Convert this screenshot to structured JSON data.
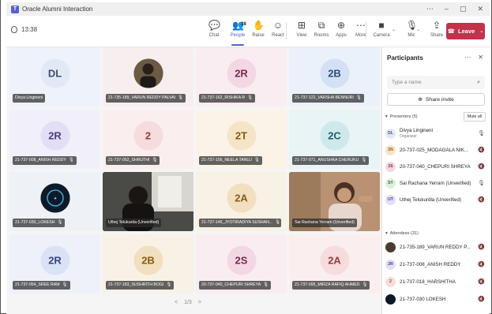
{
  "window": {
    "title": "Oracle Alumni Interaction",
    "app_icon": "teams-icon"
  },
  "toolbar": {
    "timer": "13:38",
    "buttons": [
      {
        "id": "chat",
        "label": "Chat",
        "icon": "chat-icon",
        "glyph": "💬"
      },
      {
        "id": "people",
        "label": "People",
        "icon": "people-icon",
        "glyph": "👥",
        "badge": "38"
      },
      {
        "id": "raise",
        "label": "Raise",
        "icon": "hand-icon",
        "glyph": "✋"
      },
      {
        "id": "react",
        "label": "React",
        "icon": "smiley-icon",
        "glyph": "☺"
      },
      {
        "id": "view",
        "label": "View",
        "icon": "grid-icon",
        "glyph": "⊞"
      },
      {
        "id": "rooms",
        "label": "Rooms",
        "icon": "rooms-icon",
        "glyph": "⧉"
      },
      {
        "id": "apps",
        "label": "Apps",
        "icon": "apps-icon",
        "glyph": "⊕"
      },
      {
        "id": "more",
        "label": "More",
        "icon": "ellipsis-icon",
        "glyph": "⋯"
      },
      {
        "id": "camera",
        "label": "Camera",
        "icon": "camera-off-icon",
        "glyph": "■"
      },
      {
        "id": "mic",
        "label": "Mic",
        "icon": "mic-icon",
        "glyph": "🎙"
      },
      {
        "id": "share",
        "label": "Share",
        "icon": "share-icon",
        "glyph": "⇪"
      }
    ],
    "leave_label": "Leave",
    "leave_color": "#c4314b"
  },
  "tiles": [
    {
      "name": "Divya Lingineni",
      "initials": "DL",
      "bg": "#eef3fb",
      "fg": "#3d4f73",
      "av": "#e2e9f6",
      "type": "avatar",
      "muted": false
    },
    {
      "name": "21-735-189_VARUN REDDY PALVAI",
      "initials": "",
      "bg": "#f7eeef",
      "fg": "#333",
      "av": "#4a3a30",
      "type": "photo",
      "muted": true
    },
    {
      "name": "21-737-162_RISHIKA R",
      "initials": "2R",
      "bg": "#f9edf2",
      "fg": "#7a2a4e",
      "av": "#f3d7e4",
      "type": "avatar",
      "muted": true
    },
    {
      "name": "21-737-122_VARSHA BENNURI",
      "initials": "2B",
      "bg": "#ebf1fb",
      "fg": "#2b4c82",
      "av": "#d4e0f5",
      "type": "avatar",
      "muted": true
    },
    {
      "name": "21-737-008_ANISH REDDY",
      "initials": "2R",
      "bg": "#f1effa",
      "fg": "#4a3d82",
      "av": "#e3def5",
      "type": "avatar",
      "muted": true
    },
    {
      "name": "21-737-052_SHRUTHI",
      "initials": "2",
      "bg": "#fbeeee",
      "fg": "#9a3c3c",
      "av": "#f6dcdc",
      "type": "avatar",
      "muted": true
    },
    {
      "name": "21-737-156_NEELA TANUJ",
      "initials": "2T",
      "bg": "#fbf3e8",
      "fg": "#8a5a12",
      "av": "#f6e4c6",
      "type": "avatar",
      "muted": true
    },
    {
      "name": "21-737-071_ANUSHKA CHERUKU",
      "initials": "2C",
      "bg": "#e8f4f6",
      "fg": "#1e5f6a",
      "av": "#cfe8ec",
      "type": "avatar",
      "muted": true
    },
    {
      "name": "21-737-030_LOKESH",
      "initials": "",
      "bg": "#eef1f6",
      "fg": "#fff",
      "av": "#0d1a2a",
      "type": "logo",
      "muted": true
    },
    {
      "name": "Uthej Telukurda (Unverified)",
      "initials": "",
      "bg": "#3d3d3d",
      "fg": "#fff",
      "av": "#2a2a2a",
      "type": "video-dark",
      "muted": false
    },
    {
      "name": "21-737-146_JYOTIRADIYA SUSHAN...",
      "initials": "2A",
      "bg": "#f8f1e6",
      "fg": "#8a5a12",
      "av": "#f1dfbf",
      "type": "avatar",
      "muted": true
    },
    {
      "name": "Sai Rachana Yerram (Unverified)",
      "initials": "",
      "bg": "#8a6a4e",
      "fg": "#fff",
      "av": "#5a4030",
      "type": "video-light",
      "muted": false
    },
    {
      "name": "21-737-054_SREE RAM",
      "initials": "2R",
      "bg": "#eef1fa",
      "fg": "#33457d",
      "av": "#dbe2f5",
      "type": "avatar",
      "muted": true
    },
    {
      "name": "21-737-183_SUSHRITH BOGI",
      "initials": "2B",
      "bg": "#f8f1e6",
      "fg": "#8a5a12",
      "av": "#f1dfbf",
      "type": "avatar",
      "muted": true
    },
    {
      "name": "20-737-040_CHEPURI SHREYA",
      "initials": "2S",
      "bg": "#f9edf2",
      "fg": "#7a2a4e",
      "av": "#f3d7e4",
      "type": "avatar",
      "muted": true
    },
    {
      "name": "21-737-095_MIRZA RAFIQ AHMED",
      "initials": "2A",
      "bg": "#fbeeee",
      "fg": "#9a3c3c",
      "av": "#f6dcdc",
      "type": "avatar",
      "muted": true
    }
  ],
  "pager": {
    "prev": "<",
    "label": "1/3",
    "next": ">"
  },
  "panel": {
    "title": "Participants",
    "search_placeholder": "Type a name",
    "share_invite": "Share invite",
    "presenters_header": "Presenters (5)",
    "mute_all": "Mute all",
    "attendees_header": "Attendees (31)",
    "presenters": [
      {
        "initials": "DL",
        "name": "Divya Lingineni",
        "sub": "Organizer",
        "av": "#e2e9f6",
        "fg": "#3d4f73",
        "mic": "on"
      },
      {
        "initials": "2N",
        "name": "20-737-025_MODAGALA NIK...",
        "sub": "",
        "av": "#f6e4c6",
        "fg": "#8a5a12",
        "mic": "off"
      },
      {
        "initials": "2S",
        "name": "20-737-040_CHEPURI SHREYA",
        "sub": "",
        "av": "#f3d7e4",
        "fg": "#7a2a4e",
        "mic": "off"
      },
      {
        "initials": "SY",
        "name": "Sai Rachana Yerram (Unverified)",
        "sub": "",
        "av": "#dcefd9",
        "fg": "#2f6b2a",
        "mic": "on"
      },
      {
        "initials": "UT",
        "name": "Uthej Telukurdla (Unverified)",
        "sub": "",
        "av": "#e3def5",
        "fg": "#4a3d82",
        "mic": "off"
      }
    ],
    "attendees": [
      {
        "initials": "",
        "name": "21-735-189_VARUN REDDY P...",
        "sub": "",
        "av": "#4a3a30",
        "fg": "#fff",
        "mic": "off"
      },
      {
        "initials": "2R",
        "name": "21-737-008_ANISH REDDY",
        "sub": "",
        "av": "#e3def5",
        "fg": "#4a3d82",
        "mic": "off"
      },
      {
        "initials": "2",
        "name": "21-737-018_HARSHITHA",
        "sub": "",
        "av": "#f6dcdc",
        "fg": "#9a3c3c",
        "mic": "off"
      },
      {
        "initials": "",
        "name": "21-737-030 LOKESH",
        "sub": "",
        "av": "#0d1a2a",
        "fg": "#fff",
        "mic": "off"
      }
    ]
  }
}
